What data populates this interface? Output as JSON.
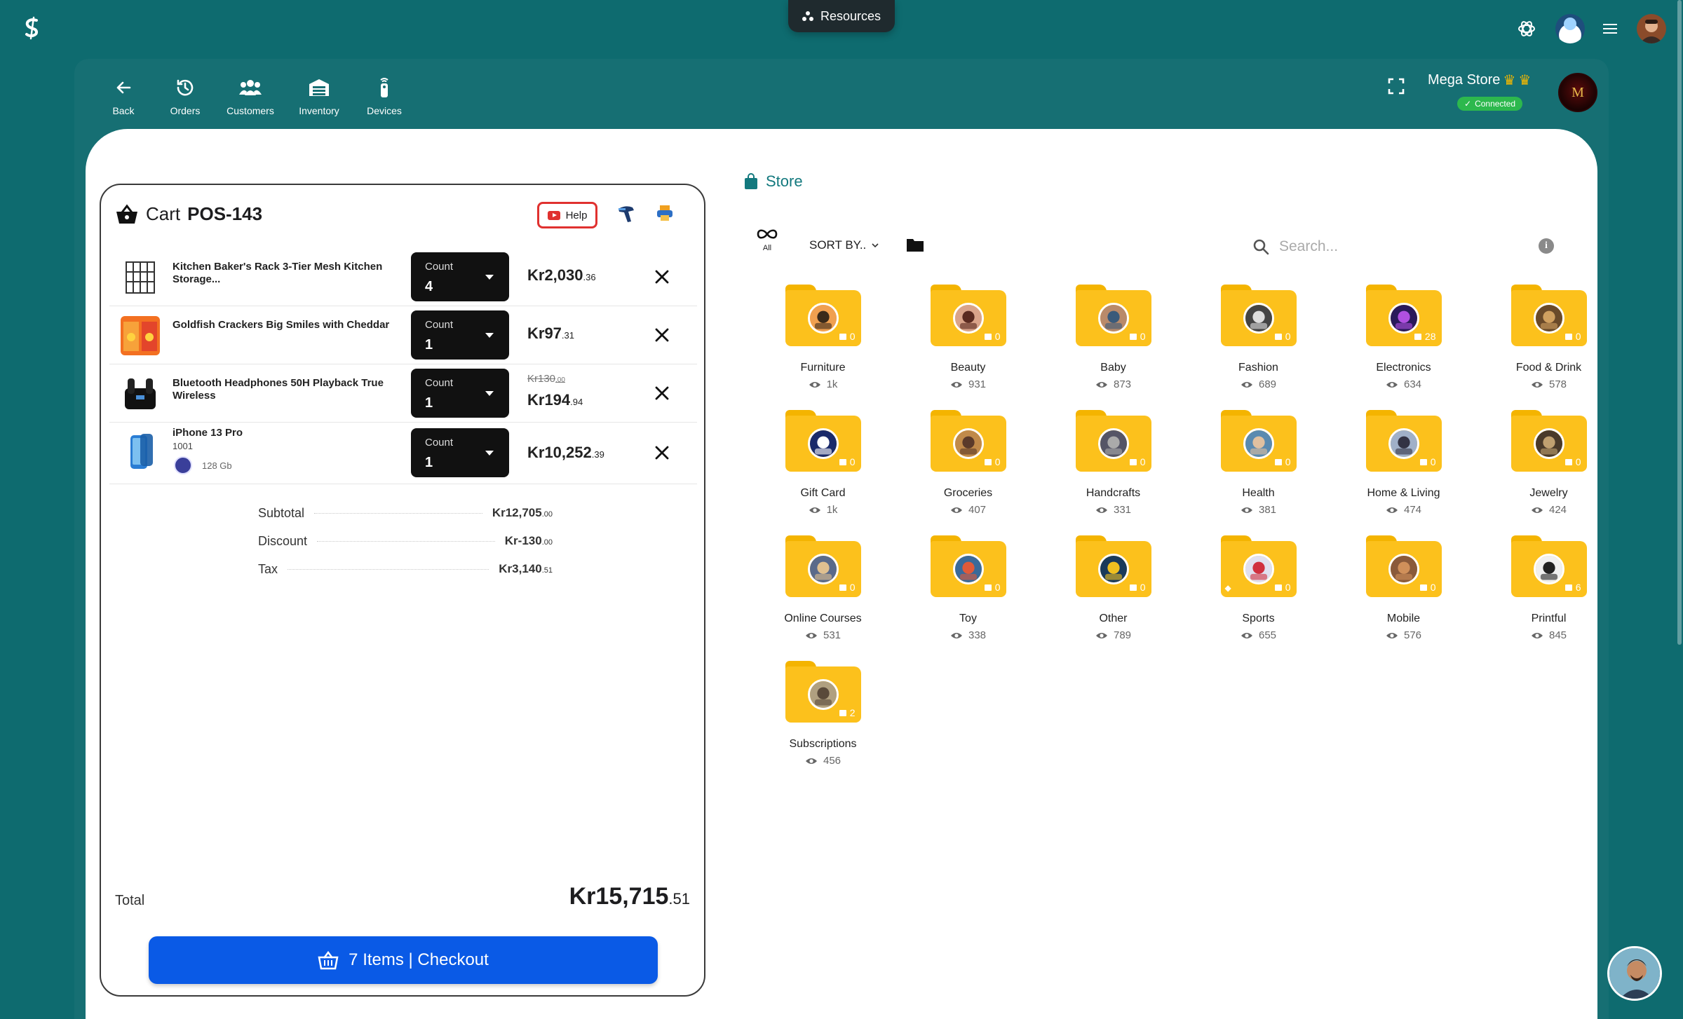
{
  "top": {
    "resources_label": "Resources"
  },
  "nav": {
    "items": [
      {
        "label": "Back",
        "icon": "back-arrow-icon"
      },
      {
        "label": "Orders",
        "icon": "history-icon"
      },
      {
        "label": "Customers",
        "icon": "users-icon"
      },
      {
        "label": "Inventory",
        "icon": "warehouse-icon"
      },
      {
        "label": "Devices",
        "icon": "remote-icon"
      }
    ]
  },
  "store": {
    "name": "Mega Store",
    "status": "Connected",
    "logo_text": "M"
  },
  "cart": {
    "title": "Cart",
    "code": "POS-143",
    "help_label": "Help",
    "count_label": "Count",
    "items": [
      {
        "name": "Kitchen Baker's Rack 3-Tier Mesh Kitchen Storage...",
        "count": "4",
        "price_main": "Kr2,030",
        "price_cents": ".36",
        "thumb": "rack"
      },
      {
        "name": "Goldfish Crackers Big Smiles with Cheddar",
        "count": "1",
        "price_main": "Kr97",
        "price_cents": ".31",
        "thumb": "crackers"
      },
      {
        "name": "Bluetooth Headphones 50H Playback True Wireless",
        "count": "1",
        "price_old_main": "Kr130",
        "price_old_cents": ".00",
        "price_main": "Kr194",
        "price_cents": ".94",
        "thumb": "headphones"
      },
      {
        "name": "iPhone 13 Pro",
        "sku": "1001",
        "variant": "128 Gb",
        "count": "1",
        "price_main": "Kr10,252",
        "price_cents": ".39",
        "thumb": "phone"
      }
    ],
    "summary": {
      "subtotal_label": "Subtotal",
      "subtotal_main": "Kr12,705",
      "subtotal_cents": ".00",
      "discount_label": "Discount",
      "discount_main": "Kr-130",
      "discount_cents": ".00",
      "tax_label": "Tax",
      "tax_main": "Kr3,140",
      "tax_cents": ".51"
    },
    "total_label": "Total",
    "total_main": "Kr15,715",
    "total_cents": ".51",
    "checkout_label": "7 Items | Checkout"
  },
  "catalog": {
    "title": "Store",
    "all_label": "All",
    "sort_label": "SORT BY..",
    "search_placeholder": "Search...",
    "categories": [
      {
        "name": "Furniture",
        "views": "1k",
        "count": "0"
      },
      {
        "name": "Beauty",
        "views": "931",
        "count": "0"
      },
      {
        "name": "Baby",
        "views": "873",
        "count": "0"
      },
      {
        "name": "Fashion",
        "views": "689",
        "count": "0"
      },
      {
        "name": "Electronics",
        "views": "634",
        "count": "28"
      },
      {
        "name": "Food & Drink",
        "views": "578",
        "count": "0"
      },
      {
        "name": "Gift Card",
        "views": "1k",
        "count": "0"
      },
      {
        "name": "Groceries",
        "views": "407",
        "count": "0"
      },
      {
        "name": "Handcrafts",
        "views": "331",
        "count": "0"
      },
      {
        "name": "Health",
        "views": "381",
        "count": "0"
      },
      {
        "name": "Home & Living",
        "views": "474",
        "count": "0"
      },
      {
        "name": "Jewelry",
        "views": "424",
        "count": "0"
      },
      {
        "name": "Online Courses",
        "views": "531",
        "count": "0"
      },
      {
        "name": "Toy",
        "views": "338",
        "count": "0"
      },
      {
        "name": "Other",
        "views": "789",
        "count": "0"
      },
      {
        "name": "Sports",
        "views": "655",
        "count": "0"
      },
      {
        "name": "Mobile",
        "views": "576",
        "count": "0"
      },
      {
        "name": "Printful",
        "views": "845",
        "count": "6"
      },
      {
        "name": "Subscriptions",
        "views": "456",
        "count": "2"
      }
    ]
  },
  "colors": {
    "background": "#0e6b6f",
    "panel": "#166f73",
    "accent": "#13797e",
    "folder": "#fcc11c",
    "checkout": "#0a5ae6",
    "connected": "#2db84d",
    "help": "#e0312f"
  }
}
